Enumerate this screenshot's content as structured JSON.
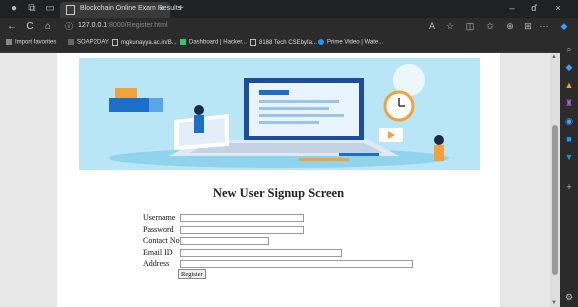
{
  "browser": {
    "tab_title": "Blockchain Online Exam Results",
    "tab_close": "×",
    "new_tab": "+",
    "url_host": "127.0.0.1",
    "url_rest": ":8000/Register.html",
    "icons": {
      "back": "←",
      "refresh": "C",
      "home": "⌂",
      "info": "ⓘ",
      "minimize": "–",
      "restore": "ď",
      "close": "×",
      "more": "···"
    },
    "favorites": [
      {
        "label": "Import favorites"
      },
      {
        "label": "SOAP2DAY"
      },
      {
        "label": "mgkunayya.ac.in/B..."
      },
      {
        "label": "Dashboard | Hacker..."
      },
      {
        "label": "8188 Tech CSEbyfa..."
      },
      {
        "label": "Prime Video | Wate..."
      }
    ]
  },
  "page": {
    "heading": "New User Signup Screen",
    "form": {
      "username_label": "Username",
      "password_label": "Password",
      "contact_label": "Contact No",
      "email_label": "Email ID",
      "address_label": "Address",
      "register_button": "Register"
    }
  },
  "colors": {
    "banner_bg": "#b9e6f6",
    "accent_blue": "#1b6fc9",
    "accent_orange": "#f2a13b"
  }
}
